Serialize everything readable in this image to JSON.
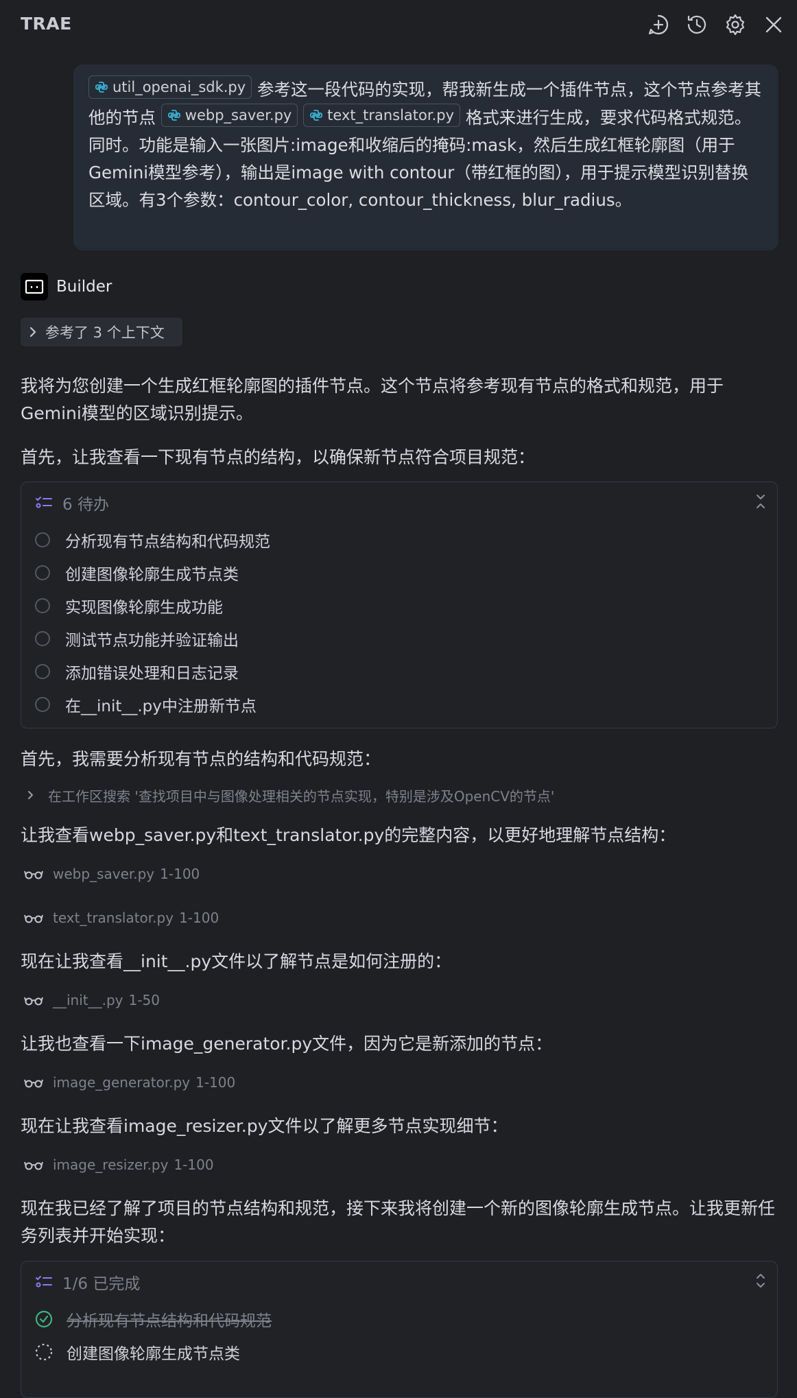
{
  "header": {
    "title": "TRAE",
    "icons": [
      "new-chat-icon",
      "history-icon",
      "settings-icon",
      "close-icon"
    ]
  },
  "user_message": {
    "chips": [
      "util_openai_sdk.py",
      "webp_saver.py",
      "text_translator.py"
    ],
    "text_1": "参考这一段代码的实现，帮我新生成一个插件节点，这个节点参考其他的节点",
    "text_2": "格式来进行生成，要求代码格式规范。同时。功能是输入一张图片:image和收缩后的掩码:mask，然后生成红框轮廓图（用于Gemini模型参考），输出是image with contour（带红框的图），用于提示模型识别替换区域。有3个参数：contour_color, contour_thickness, blur_radius。"
  },
  "assistant": {
    "name": "Builder",
    "context_label": "参考了 3 个上下文",
    "intro": "我将为您创建一个生成红框轮廓图的插件节点。这个节点将参考现有节点的格式和规范，用于Gemini模型的区域识别提示。",
    "step_1": "首先，让我查看一下现有节点的结构，以确保新节点符合项目规范：",
    "todo_1": {
      "header": "6 待办",
      "items": [
        "分析现有节点结构和代码规范",
        "创建图像轮廓生成节点类",
        "实现图像轮廓生成功能",
        "测试节点功能并验证输出",
        "添加错误处理和日志记录",
        "在__init__.py中注册新节点"
      ]
    },
    "step_2": "首先，我需要分析现有节点的结构和代码规范：",
    "search": "在工作区搜索 '查找项目中与图像处理相关的节点实现，特别是涉及OpenCV的节点'",
    "step_3": "让我查看webp_saver.py和text_translator.py的完整内容，以更好地理解节点结构：",
    "read_1": {
      "file": "webp_saver.py",
      "range": "1-100"
    },
    "read_2": {
      "file": "text_translator.py",
      "range": "1-100"
    },
    "step_4": "现在让我查看__init__.py文件以了解节点是如何注册的：",
    "read_3": {
      "file": "__init__.py",
      "range": "1-50"
    },
    "step_5": "让我也查看一下image_generator.py文件，因为它是新添加的节点：",
    "read_4": {
      "file": "image_generator.py",
      "range": "1-100"
    },
    "step_6": "现在让我查看image_resizer.py文件以了解更多节点实现细节：",
    "read_5": {
      "file": "image_resizer.py",
      "range": "1-100"
    },
    "step_7": "现在我已经了解了项目的节点结构和规范，接下来我将创建一个新的图像轮廓生成节点。让我更新任务列表并开始实现：",
    "todo_2": {
      "header": "1/6 已完成",
      "items": [
        {
          "label": "分析现有节点结构和代码规范",
          "status": "done"
        },
        {
          "label": "创建图像轮廓生成节点类",
          "status": "in-progress"
        }
      ]
    }
  },
  "colors": {
    "background": "#1f2023",
    "user_bubble": "#262c36",
    "accent_todo": "#8b7cf6",
    "done_green": "#3fb37f"
  }
}
